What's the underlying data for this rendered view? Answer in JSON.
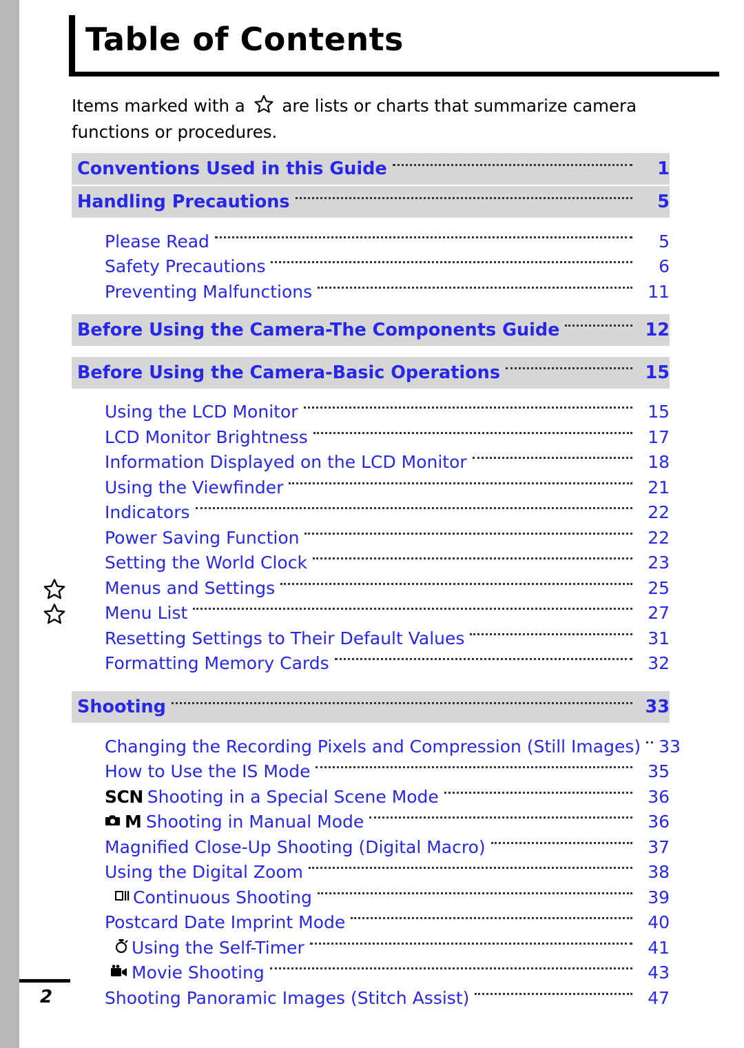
{
  "document": {
    "title": "Table of Contents",
    "intro_before": "Items marked with a",
    "intro_after": "are lists or charts that summarize camera functions or procedures.",
    "page_number": "2",
    "accent_color": "#2727e8",
    "band_color": "#d6d6d6"
  },
  "toc": [
    {
      "level": 1,
      "label": "Conventions Used in this Guide",
      "page": "1"
    },
    {
      "level": 1,
      "label": "Handling Precautions",
      "page": "5"
    },
    {
      "level": 2,
      "label": "Please Read",
      "page": "5"
    },
    {
      "level": 2,
      "label": "Safety Precautions",
      "page": "6"
    },
    {
      "level": 2,
      "label": "Preventing Malfunctions",
      "page": "11"
    },
    {
      "level": 1,
      "label": "Before Using the Camera-The Components Guide",
      "page": "12"
    },
    {
      "level": 1,
      "label": "Before Using the Camera-Basic Operations",
      "page": "15"
    },
    {
      "level": 2,
      "label": "Using the LCD Monitor",
      "page": "15"
    },
    {
      "level": 2,
      "label": "LCD Monitor Brightness",
      "page": "17"
    },
    {
      "level": 2,
      "label": "Information Displayed on the LCD Monitor",
      "page": "18"
    },
    {
      "level": 2,
      "label": "Using the Viewfinder",
      "page": "21"
    },
    {
      "level": 2,
      "label": "Indicators",
      "page": "22"
    },
    {
      "level": 2,
      "label": "Power Saving Function",
      "page": "22"
    },
    {
      "level": 2,
      "label": "Setting the World Clock",
      "page": "23"
    },
    {
      "level": 2,
      "label": "Menus and Settings",
      "page": "25",
      "star": true
    },
    {
      "level": 2,
      "label": "Menu List",
      "page": "27",
      "star": true
    },
    {
      "level": 2,
      "label": "Resetting Settings to Their Default Values",
      "page": "31"
    },
    {
      "level": 2,
      "label": "Formatting Memory Cards",
      "page": "32"
    },
    {
      "level": 1,
      "label": "Shooting",
      "page": "33"
    },
    {
      "level": 2,
      "label": "Changing the Recording Pixels and Compression (Still Images)",
      "page": "33"
    },
    {
      "level": 2,
      "label": "How to Use the IS Mode",
      "page": "35"
    },
    {
      "level": 2,
      "label": "Shooting in a Special Scene Mode",
      "page": "36",
      "icon": "scn-mode-icon",
      "icon_text": "SCN"
    },
    {
      "level": 2,
      "label": "Shooting in Manual Mode",
      "page": "36",
      "icon": "camera-manual-icon",
      "icon_text": "M"
    },
    {
      "level": 2,
      "label": "Magnified Close-Up Shooting (Digital Macro)",
      "page": "37"
    },
    {
      "level": 2,
      "label": "Using the Digital Zoom",
      "page": "38"
    },
    {
      "level": 2,
      "label": "Continuous Shooting",
      "page": "39",
      "icon": "continuous-shooting-icon"
    },
    {
      "level": 2,
      "label": "Postcard Date Imprint Mode",
      "page": "40"
    },
    {
      "level": 2,
      "label": "Using the Self-Timer",
      "page": "41",
      "icon": "self-timer-icon"
    },
    {
      "level": 2,
      "label": "Movie Shooting",
      "page": "43",
      "icon": "movie-camera-icon"
    },
    {
      "level": 2,
      "label": "Shooting Panoramic Images (Stitch Assist)",
      "page": "47"
    }
  ]
}
